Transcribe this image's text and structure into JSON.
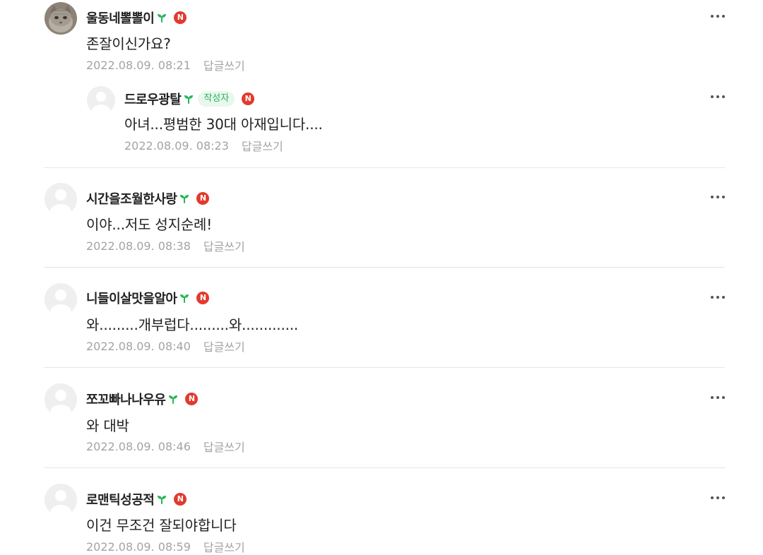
{
  "comments": [
    {
      "nickname": "울동네뽈뽈이",
      "naver_badge": "N",
      "text": "존잘이신가요?",
      "date": "2022.08.09. 08:21",
      "reply_label": "답글쓰기",
      "avatar": "cat-photo"
    },
    {
      "nickname": "드로우광탈",
      "author_badge": "작성자",
      "naver_badge": "N",
      "text": "아녀...평범한 30대 아재입니다....",
      "date": "2022.08.09. 08:23",
      "reply_label": "답글쓰기",
      "avatar": "default-profile",
      "is_reply": true
    },
    {
      "nickname": "시간을조월한사랑",
      "naver_badge": "N",
      "text": "이야...저도 성지순례!",
      "date": "2022.08.09. 08:38",
      "reply_label": "답글쓰기",
      "avatar": "default-profile"
    },
    {
      "nickname": "니들이살맛을알아",
      "naver_badge": "N",
      "text": "와.........개부럽다.........와.............",
      "date": "2022.08.09. 08:40",
      "reply_label": "답글쓰기",
      "avatar": "default-profile"
    },
    {
      "nickname": "쪼꼬빠나나우유",
      "naver_badge": "N",
      "text": "와 대박",
      "date": "2022.08.09. 08:46",
      "reply_label": "답글쓰기",
      "avatar": "default-profile"
    },
    {
      "nickname": "로맨틱성공적",
      "naver_badge": "N",
      "text": "이건 무조건 잘되야합니다",
      "date": "2022.08.09. 08:59",
      "reply_label": "답글쓰기",
      "avatar": "default-profile"
    }
  ],
  "icons": {
    "sprout": "sprout-icon",
    "naver_badge": "naver-n-icon",
    "more": "more-options-icon"
  },
  "colors": {
    "sprout_green": "#28b45a",
    "naver_red": "#e23a2e",
    "author_badge_bg": "#e9f8ee",
    "meta_gray": "#a3a3a3"
  }
}
